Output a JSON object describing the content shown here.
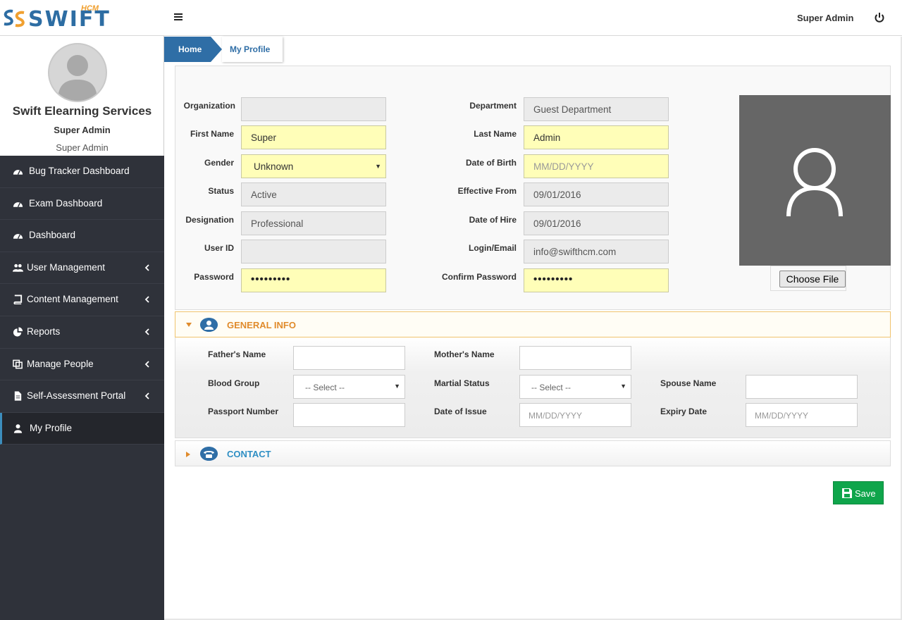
{
  "header": {
    "logo_text": "SWIFT",
    "logo_sub": "HCM",
    "user_name": "Super Admin"
  },
  "sidebar": {
    "org_name": "Swift Elearning Services",
    "role_primary": "Super Admin",
    "role_secondary": "Super Admin",
    "items": [
      {
        "label": "Bug Tracker Dashboard",
        "icon": "dashboard-icon"
      },
      {
        "label": "Exam Dashboard",
        "icon": "dashboard-icon"
      },
      {
        "label": "Dashboard",
        "icon": "dashboard-icon"
      },
      {
        "label": "User Management",
        "icon": "users-icon"
      },
      {
        "label": "Content Management",
        "icon": "book-icon"
      },
      {
        "label": "Reports",
        "icon": "pie-chart-icon"
      },
      {
        "label": "Manage People",
        "icon": "copy-icon"
      },
      {
        "label": "Self-Assessment Portal",
        "icon": "document-icon"
      },
      {
        "label": "My Profile",
        "icon": "user-icon"
      }
    ]
  },
  "breadcrumb": {
    "home": "Home",
    "current": "My Profile"
  },
  "profile": {
    "organization": {
      "label": "Organization",
      "value": ""
    },
    "department": {
      "label": "Department",
      "value": "Guest Department"
    },
    "first_name": {
      "label": "First Name",
      "value": "Super"
    },
    "last_name": {
      "label": "Last Name",
      "value": "Admin"
    },
    "gender": {
      "label": "Gender",
      "value": "Unknown"
    },
    "dob": {
      "label": "Date of Birth",
      "placeholder": "MM/DD/YYYY"
    },
    "status": {
      "label": "Status",
      "value": "Active"
    },
    "effective_from": {
      "label": "Effective From",
      "value": "09/01/2016"
    },
    "designation": {
      "label": "Designation",
      "value": "Professional"
    },
    "date_of_hire": {
      "label": "Date of Hire",
      "value": "09/01/2016"
    },
    "user_id": {
      "label": "User ID",
      "value": ""
    },
    "login_email": {
      "label": "Login/Email",
      "value": "info@swifthcm.com"
    },
    "password": {
      "label": "Password",
      "value": "•••••••••"
    },
    "confirm_password": {
      "label": "Confirm Password",
      "value": "•••••••••"
    },
    "choose_file": "Choose File"
  },
  "general_info": {
    "title": "GENERAL INFO",
    "fathers_name": {
      "label": "Father's Name",
      "value": ""
    },
    "mothers_name": {
      "label": "Mother's Name",
      "value": ""
    },
    "blood_group": {
      "label": "Blood Group",
      "value": "-- Select --"
    },
    "martial_status": {
      "label": "Martial Status",
      "value": "-- Select --"
    },
    "spouse_name": {
      "label": "Spouse Name",
      "value": ""
    },
    "passport_number": {
      "label": "Passport Number",
      "value": ""
    },
    "date_of_issue": {
      "label": "Date of Issue",
      "placeholder": "MM/DD/YYYY"
    },
    "expiry_date": {
      "label": "Expiry Date",
      "placeholder": "MM/DD/YYYY"
    }
  },
  "contact": {
    "title": "CONTACT"
  },
  "actions": {
    "save": "Save"
  },
  "colors": {
    "sidebar_bg": "#2f323a",
    "brand_blue": "#2f6ea6",
    "required_yellow": "#fffeb8",
    "save_green": "#0fa54b",
    "general_orange": "#e08b2c"
  }
}
